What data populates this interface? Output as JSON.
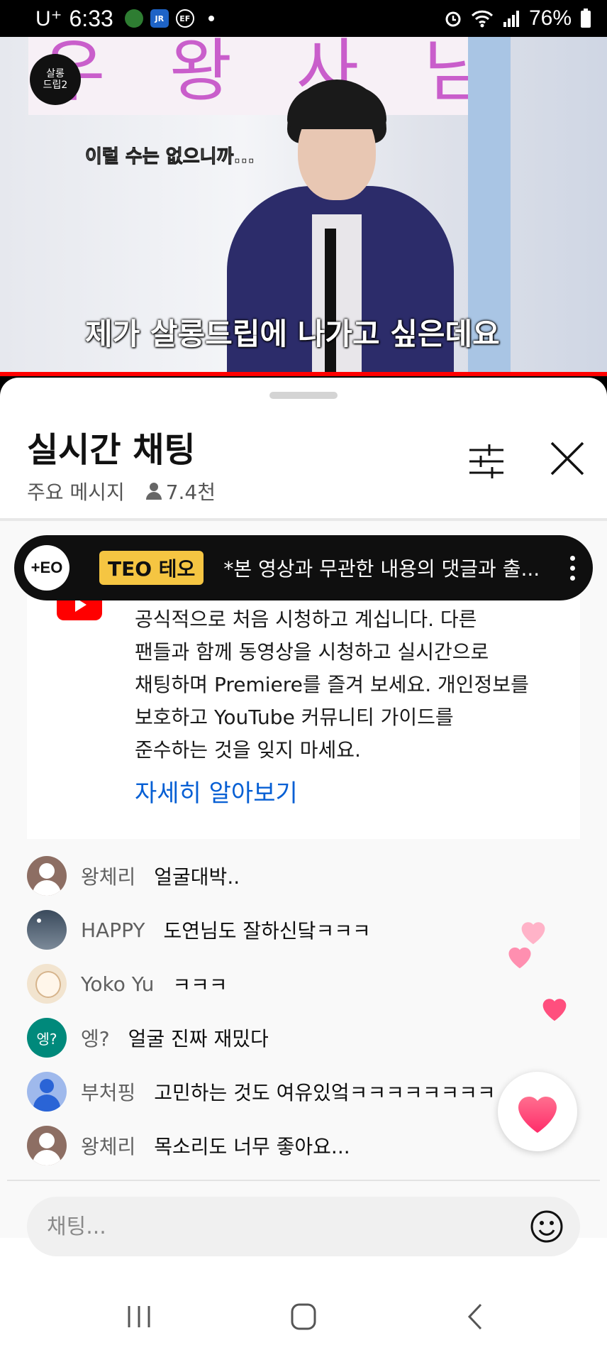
{
  "status_bar": {
    "carrier": "U⁺",
    "time": "6:33",
    "icons_left": [
      "globe-icon",
      "jr-icon",
      "ef-icon"
    ],
    "battery": "76%"
  },
  "video": {
    "poster_text": "우 왕 사 님",
    "logo_text": "살롱\n드립2",
    "subtitle_small": "이럴 수는 없으니까...",
    "subtitle_main": "제가 살롱드립에 나가고 싶은데요"
  },
  "chat": {
    "title": "실시간 채팅",
    "mode": "주요 메시지",
    "viewers": "7.4천",
    "pinned": {
      "logo": "+EO",
      "author": "TEO 테오",
      "text": "*본 영상과 무관한 내용의 댓글과 출..."
    },
    "welcome": {
      "lines": [
        "공식적으로 처음 시청하고 계십니다. 다른",
        "팬들과 함께 동영상을 시청하고 실시간으로",
        "채팅하며 Premiere를 즐겨 보세요. 개인정보를",
        "보호하고 YouTube 커뮤니티 가이드를",
        "준수하는 것을 잊지 마세요."
      ],
      "learn_more": "자세히 알아보기"
    },
    "messages": [
      {
        "author": "왕체리",
        "text": "얼굴대박..",
        "avatar": "default"
      },
      {
        "author": "HAPPY",
        "text": "도연님도 잘하신닼ㅋㅋㅋ",
        "avatar": "sky"
      },
      {
        "author": "Yoko Yu",
        "text": "ㅋㅋㅋ",
        "avatar": "doll"
      },
      {
        "author": "엥?",
        "text": "얼굴 진짜 재밌다",
        "avatar": "teal",
        "avatar_text": "엥?"
      },
      {
        "author": "부처핑",
        "text": "고민하는 것도 여유있엌ㅋㅋㅋㅋㅋㅋㅋㅋ",
        "avatar": "blue"
      },
      {
        "author": "왕체리",
        "text": "목소리도 너무 좋아요...",
        "avatar": "default"
      }
    ],
    "input_placeholder": "채팅..."
  },
  "colors": {
    "accent_red": "#ff0000",
    "link_blue": "#065fd4",
    "badge_yellow": "#f5c542",
    "heart_pink": "#ff4f7e"
  }
}
